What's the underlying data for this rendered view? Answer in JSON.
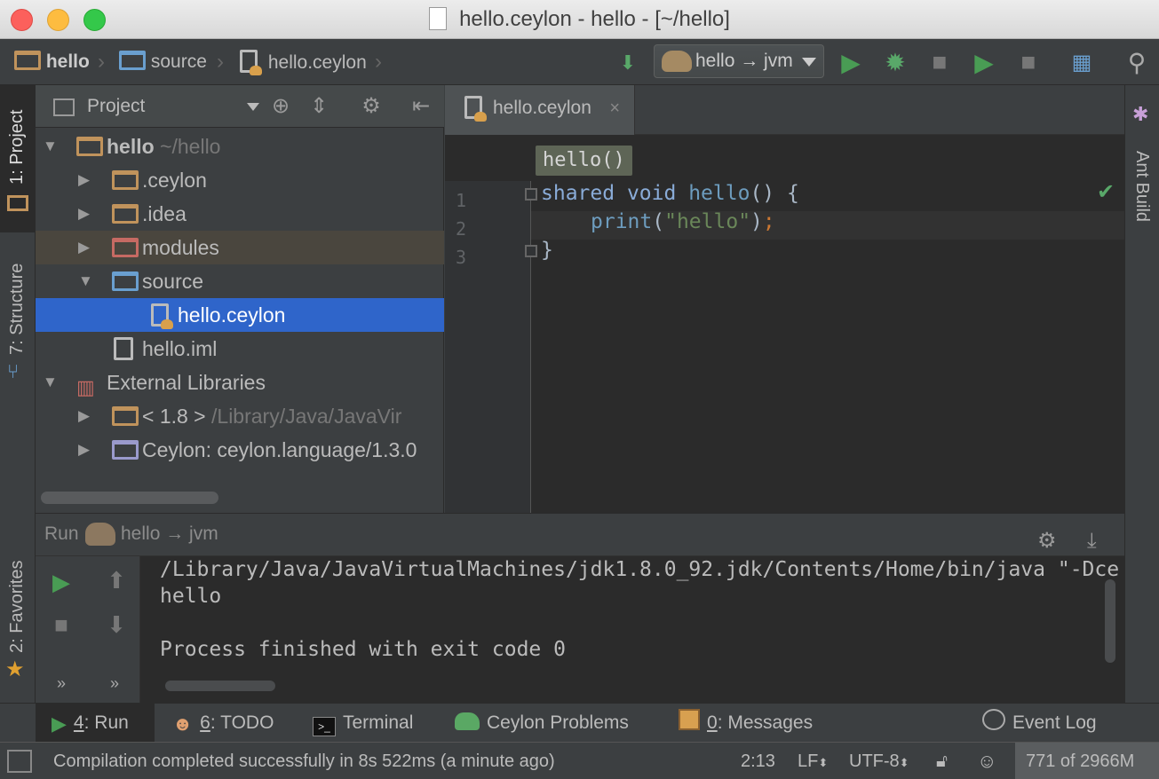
{
  "window": {
    "title": "hello.ceylon - hello - [~/hello]"
  },
  "breadcrumbs": [
    {
      "label": "hello"
    },
    {
      "label": "source"
    },
    {
      "label": "hello.ceylon"
    }
  ],
  "toolbar": {
    "run_config": "hello → jvm"
  },
  "left_strip": {
    "project_tab": "1: Project",
    "structure_tab": "7: Structure",
    "favorites_tab": "2: Favorites"
  },
  "right_strip": {
    "ant_tab": "Ant Build"
  },
  "project_panel": {
    "view_label": "Project",
    "tree": [
      {
        "label": "hello",
        "hint": "~/hello"
      },
      {
        "label": ".ceylon"
      },
      {
        "label": ".idea"
      },
      {
        "label": "modules"
      },
      {
        "label": "source"
      },
      {
        "label": "hello.ceylon"
      },
      {
        "label": "hello.iml"
      },
      {
        "label": "External Libraries"
      },
      {
        "label": "< 1.8 >",
        "hint": "/Library/Java/JavaVir"
      },
      {
        "label": "Ceylon: ceylon.language/1.3.0"
      }
    ]
  },
  "editor": {
    "tab_label": "hello.ceylon",
    "tab_close": "×",
    "breadcrumb_popup": "hello()",
    "line_numbers": [
      "1",
      "2",
      "3"
    ],
    "code": {
      "l1_kw1": "shared",
      "l1_kw2": "void",
      "l1_fn": "hello",
      "l1_rest": "() {",
      "l2_fn": "print",
      "l2_open": "(",
      "l2_str": "\"hello\"",
      "l2_close": ")",
      "l2_semi": ";",
      "l3": "}"
    }
  },
  "run_panel": {
    "label": "Run",
    "config": "hello → jvm",
    "console": [
      "/Library/Java/JavaVirtualMachines/jdk1.8.0_92.jdk/Contents/Home/bin/java \"-Dce",
      "hello",
      "",
      "Process finished with exit code 0"
    ]
  },
  "tool_tabs": {
    "run": {
      "num": "4",
      "rest": ": Run"
    },
    "todo": {
      "num": "6",
      "rest": ": TODO"
    },
    "terminal": "Terminal",
    "ceylon_problems": "Ceylon Problems",
    "messages": {
      "num": "0",
      "rest": ": Messages"
    },
    "event_log": "Event Log"
  },
  "status_bar": {
    "message": "Compilation completed successfully in 8s 522ms (a minute ago)",
    "position": "2:13",
    "line_sep": "LF",
    "encoding": "UTF-8",
    "memory": "771 of 2966M"
  },
  "colors": {
    "accent_selection": "#2f65ca",
    "run_green": "#499c54",
    "keyword": "#cc7832",
    "string": "#6a8759"
  }
}
